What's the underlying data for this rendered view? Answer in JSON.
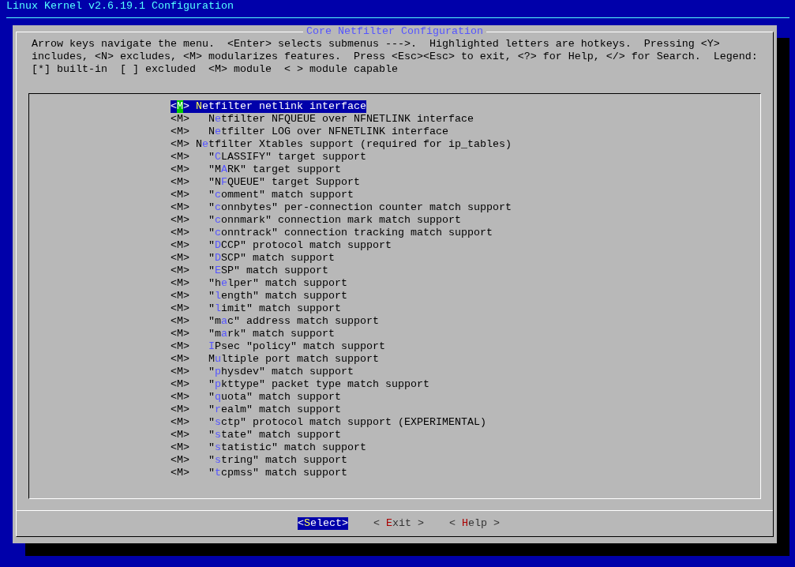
{
  "window": {
    "title": "Linux Kernel v2.6.19.1 Configuration"
  },
  "dialog": {
    "title": "Core Netfilter Configuration",
    "help_lines": [
      "Arrow keys navigate the menu.  <Enter> selects submenus --->.  Highlighted letters are hotkeys.  Pressing <Y>",
      "includes, <N> excludes, <M> modularizes features.  Press <Esc><Esc> to exit, <?> for Help, </> for Search.  Legend:",
      "[*] built-in  [ ] excluded  <M> module  < > module capable"
    ],
    "items": [
      {
        "option": "<M>",
        "hotkey": "N",
        "after": "etfilter netlink interface",
        "selected": true,
        "children": [
          {
            "option": "<M>",
            "before": "N",
            "hotkey": "e",
            "after": "tfilter NFQUEUE over NFNETLINK interface",
            "selected": false
          },
          {
            "option": "<M>",
            "before": "N",
            "hotkey": "e",
            "after": "tfilter LOG over NFNETLINK interface",
            "selected": false
          }
        ]
      },
      {
        "option": "<M>",
        "before": "N",
        "hotkey": "e",
        "after": "tfilter Xtables support (required for ip_tables)",
        "selected": false,
        "children": [
          {
            "option": "<M>",
            "before": "\"",
            "hotkey": "C",
            "after": "LASSIFY\" target support",
            "selected": false
          },
          {
            "option": "<M>",
            "before": "\"M",
            "hotkey": "A",
            "after": "RK\" target support",
            "selected": false
          },
          {
            "option": "<M>",
            "before": "\"N",
            "hotkey": "F",
            "after": "QUEUE\" target Support",
            "selected": false
          },
          {
            "option": "<M>",
            "before": "\"",
            "hotkey": "c",
            "after": "omment\" match support",
            "selected": false
          },
          {
            "option": "<M>",
            "before": "\"",
            "hotkey": "c",
            "after": "onnbytes\" per-connection counter match support",
            "selected": false
          },
          {
            "option": "<M>",
            "before": "\"",
            "hotkey": "c",
            "after": "onnmark\" connection mark match support",
            "selected": false
          },
          {
            "option": "<M>",
            "before": "\"",
            "hotkey": "c",
            "after": "onntrack\" connection tracking match support",
            "selected": false
          },
          {
            "option": "<M>",
            "before": "\"",
            "hotkey": "D",
            "after": "CCP\" protocol match support",
            "selected": false
          },
          {
            "option": "<M>",
            "before": "\"",
            "hotkey": "D",
            "after": "SCP\" match support",
            "selected": false
          },
          {
            "option": "<M>",
            "before": "\"",
            "hotkey": "E",
            "after": "SP\" match support",
            "selected": false
          },
          {
            "option": "<M>",
            "before": "\"h",
            "hotkey": "e",
            "after": "lper\" match support",
            "selected": false
          },
          {
            "option": "<M>",
            "before": "\"",
            "hotkey": "l",
            "after": "ength\" match support",
            "selected": false
          },
          {
            "option": "<M>",
            "before": "\"",
            "hotkey": "l",
            "after": "imit\" match support",
            "selected": false
          },
          {
            "option": "<M>",
            "before": "\"m",
            "hotkey": "a",
            "after": "c\" address match support",
            "selected": false
          },
          {
            "option": "<M>",
            "before": "\"m",
            "hotkey": "a",
            "after": "rk\" match support",
            "selected": false
          },
          {
            "option": "<M>",
            "hotkey": "I",
            "after": "Psec \"policy\" match support",
            "selected": false
          },
          {
            "option": "<M>",
            "before": "M",
            "hotkey": "u",
            "after": "ltiple port match support",
            "selected": false
          },
          {
            "option": "<M>",
            "before": "\"",
            "hotkey": "p",
            "after": "hysdev\" match support",
            "selected": false
          },
          {
            "option": "<M>",
            "before": "\"",
            "hotkey": "p",
            "after": "kttype\" packet type match support",
            "selected": false
          },
          {
            "option": "<M>",
            "before": "\"",
            "hotkey": "q",
            "after": "uota\" match support",
            "selected": false
          },
          {
            "option": "<M>",
            "before": "\"",
            "hotkey": "r",
            "after": "ealm\" match support",
            "selected": false
          },
          {
            "option": "<M>",
            "before": "\"",
            "hotkey": "s",
            "after": "ctp\" protocol match support (EXPERIMENTAL)",
            "selected": false
          },
          {
            "option": "<M>",
            "before": "\"",
            "hotkey": "s",
            "after": "tate\" match support",
            "selected": false
          },
          {
            "option": "<M>",
            "before": "\"",
            "hotkey": "s",
            "after": "tatistic\" match support",
            "selected": false
          },
          {
            "option": "<M>",
            "before": "\"",
            "hotkey": "s",
            "after": "tring\" match support",
            "selected": false
          },
          {
            "option": "<M>",
            "before": "\"",
            "hotkey": "t",
            "after": "cpmss\" match support",
            "selected": false
          }
        ]
      }
    ],
    "buttons": [
      {
        "before": "<",
        "hotkey": "S",
        "after": "elect>",
        "selected": true
      },
      {
        "before": "< ",
        "hotkey": "E",
        "after": "xit >",
        "selected": false
      },
      {
        "before": "< ",
        "hotkey": "H",
        "after": "elp >",
        "selected": false
      }
    ]
  }
}
